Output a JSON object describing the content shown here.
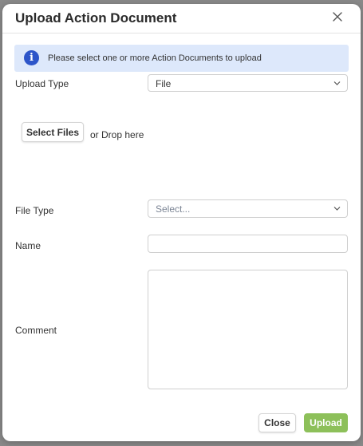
{
  "dialog": {
    "title": "Upload Action Document",
    "info_message": "Please select one or more Action Documents to upload"
  },
  "icons": {
    "close": "close-icon",
    "info": "info-icon",
    "chevron": "chevron-down-icon"
  },
  "form": {
    "upload_type": {
      "label": "Upload Type",
      "value": "File"
    },
    "files": {
      "button_label": "Select Files",
      "drop_text": "or Drop here"
    },
    "file_type": {
      "label": "File Type",
      "placeholder": "Select..."
    },
    "name": {
      "label": "Name",
      "value": ""
    },
    "comment": {
      "label": "Comment",
      "value": ""
    }
  },
  "footer": {
    "close_label": "Close",
    "upload_label": "Upload"
  },
  "colors": {
    "info_bg": "#dde8fb",
    "info_icon": "#2d55c9",
    "primary": "#8dc05a"
  }
}
